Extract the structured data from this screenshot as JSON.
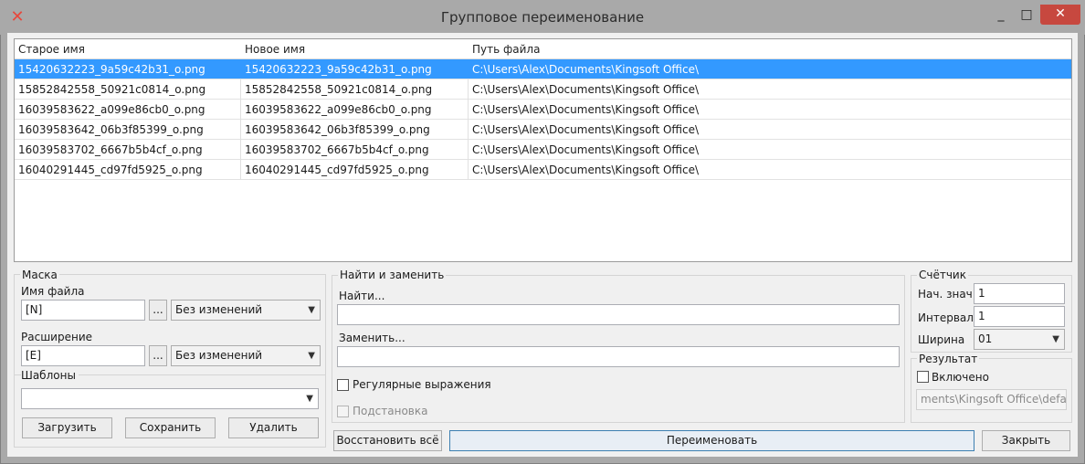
{
  "window": {
    "title": "Групповое переименование",
    "app_icon": "app-logo-icon",
    "minimize": "_",
    "maximize": "□",
    "close": "✕"
  },
  "table": {
    "headers": [
      "Старое имя",
      "Новое имя",
      "Путь файла"
    ],
    "rows": [
      {
        "old": "15420632223_9a59c42b31_o.png",
        "new": "15420632223_9a59c42b31_o.png",
        "path": "C:\\Users\\Alex\\Documents\\Kingsoft Office\\",
        "selected": true
      },
      {
        "old": "15852842558_50921c0814_o.png",
        "new": "15852842558_50921c0814_o.png",
        "path": "C:\\Users\\Alex\\Documents\\Kingsoft Office\\"
      },
      {
        "old": "16039583622_a099e86cb0_o.png",
        "new": "16039583622_a099e86cb0_o.png",
        "path": "C:\\Users\\Alex\\Documents\\Kingsoft Office\\"
      },
      {
        "old": "16039583642_06b3f85399_o.png",
        "new": "16039583642_06b3f85399_o.png",
        "path": "C:\\Users\\Alex\\Documents\\Kingsoft Office\\"
      },
      {
        "old": "16039583702_6667b5b4cf_o.png",
        "new": "16039583702_6667b5b4cf_o.png",
        "path": "C:\\Users\\Alex\\Documents\\Kingsoft Office\\"
      },
      {
        "old": "16040291445_cd97fd5925_o.png",
        "new": "16040291445_cd97fd5925_o.png",
        "path": "C:\\Users\\Alex\\Documents\\Kingsoft Office\\"
      }
    ]
  },
  "mask": {
    "title": "Маска",
    "filename_label": "Имя файла",
    "filename_value": "[N]",
    "filename_case": "Без изменений",
    "extension_label": "Расширение",
    "extension_value": "[E]",
    "extension_case": "Без изменений",
    "ellipsis": "...",
    "templates_title": "Шаблоны",
    "templates_value": "",
    "load_button": "Загрузить",
    "save_button": "Сохранить",
    "delete_button": "Удалить"
  },
  "find_replace": {
    "title": "Найти и заменить",
    "find_label": "Найти...",
    "find_value": "",
    "replace_label": "Заменить...",
    "replace_value": "",
    "regex_label": "Регулярные выражения",
    "regex_checked": false,
    "substitution_label": "Подстановка",
    "substitution_checked": false
  },
  "counter": {
    "title": "Счётчик",
    "start_label": "Нач. знач.",
    "start_value": "1",
    "interval_label": "Интервал",
    "interval_value": "1",
    "width_label": "Ширина",
    "width_value": "01"
  },
  "result": {
    "title": "Результат",
    "enabled_label": "Включено",
    "enabled_checked": false,
    "path_value": "ments\\Kingsoft Office\\default"
  },
  "actions": {
    "restore_all": "Восстановить всё",
    "rename": "Переименовать",
    "close": "Закрыть"
  }
}
